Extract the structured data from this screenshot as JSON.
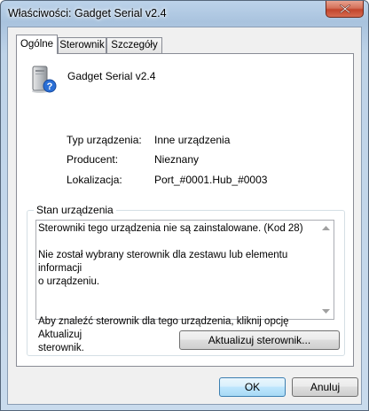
{
  "window": {
    "title": "Właściwości: Gadget Serial v2.4"
  },
  "tabs": [
    {
      "label": "Ogólne",
      "active": true
    },
    {
      "label": "Sterownik",
      "active": false
    },
    {
      "label": "Szczegóły",
      "active": false
    }
  ],
  "device": {
    "icon": "usb-device-question-icon",
    "name": "Gadget Serial v2.4"
  },
  "properties": [
    {
      "label": "Typ urządzenia:",
      "value": "Inne urządzenia"
    },
    {
      "label": "Producent:",
      "value": "Nieznany"
    },
    {
      "label": "Lokalizacja:",
      "value": "Port_#0001.Hub_#0003"
    }
  ],
  "status": {
    "group_title": "Stan urządzenia",
    "text": "Sterowniki tego urządzenia nie są zainstalowane. (Kod 28)\n\nNie został wybrany sterownik dla zestawu lub elementu informacji\no urządzeniu.\n\n\nAby znaleźć sterownik dla tego urządzenia, kliknij opcję Aktualizuj\nsterownik.",
    "update_button": "Aktualizuj sterownik..."
  },
  "footer": {
    "ok": "OK",
    "cancel": "Anuluj"
  },
  "colors": {
    "close_button": "#c2452c",
    "default_button_border": "#3c7fb1"
  }
}
